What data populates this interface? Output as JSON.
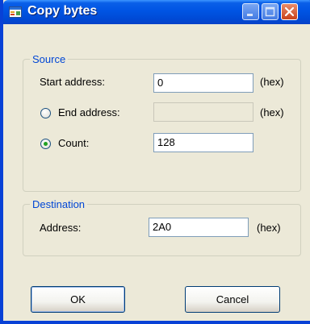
{
  "window": {
    "title": "Copy bytes",
    "icon": "app-window-icon"
  },
  "source": {
    "legend": "Source",
    "start_address": {
      "label": "Start address:",
      "value": "0",
      "unit": "(hex)"
    },
    "end_address": {
      "label": "End address:",
      "value": "",
      "unit": "(hex)",
      "selected": false,
      "enabled": false
    },
    "count": {
      "label": "Count:",
      "value": "128",
      "selected": true
    }
  },
  "destination": {
    "legend": "Destination",
    "address": {
      "label": "Address:",
      "value": "2A0",
      "unit": "(hex)"
    }
  },
  "buttons": {
    "ok": "OK",
    "cancel": "Cancel"
  },
  "colors": {
    "titlebar": "#0054e3",
    "close": "#c9431c",
    "legend": "#0046d5",
    "radio_dot": "#21a121"
  }
}
